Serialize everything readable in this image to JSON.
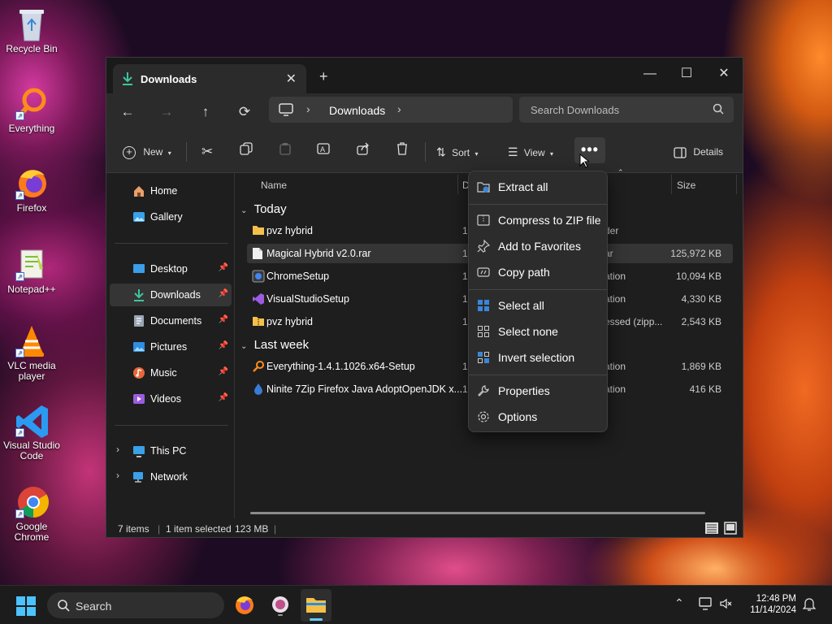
{
  "desktop": {
    "icons": [
      {
        "label": "Recycle Bin",
        "icon": "recycle-bin-icon"
      },
      {
        "label": "Everything",
        "icon": "everything-icon"
      },
      {
        "label": "Firefox",
        "icon": "firefox-icon"
      },
      {
        "label": "Notepad++",
        "icon": "notepad-plus-plus-icon"
      },
      {
        "label": "VLC media player",
        "icon": "vlc-icon"
      },
      {
        "label": "Visual Studio Code",
        "icon": "vscode-icon"
      },
      {
        "label": "Google Chrome",
        "icon": "chrome-icon"
      }
    ]
  },
  "window": {
    "tab_title": "Downloads",
    "new_tab": "+",
    "close_tab": "✕",
    "controls": {
      "minimize": "—",
      "maximize": "☐",
      "close": "✕"
    },
    "nav": {
      "back": "←",
      "forward": "→",
      "up": "↑",
      "refresh": "⟳"
    },
    "address": {
      "location": "Downloads",
      "separator": "›"
    },
    "search": {
      "placeholder": "Search Downloads"
    },
    "toolbar": {
      "new": "New",
      "sort": "Sort",
      "view": "View",
      "details": "Details",
      "more": "•••"
    },
    "sidebar": [
      {
        "label": "Home",
        "icon": "home-icon"
      },
      {
        "label": "Gallery",
        "icon": "gallery-icon"
      },
      {
        "label": "Desktop",
        "icon": "desktop-icon",
        "pinned": true
      },
      {
        "label": "Downloads",
        "icon": "downloads-icon",
        "pinned": true,
        "selected": true
      },
      {
        "label": "Documents",
        "icon": "documents-icon",
        "pinned": true
      },
      {
        "label": "Pictures",
        "icon": "pictures-icon",
        "pinned": true
      },
      {
        "label": "Music",
        "icon": "music-icon",
        "pinned": true
      },
      {
        "label": "Videos",
        "icon": "videos-icon",
        "pinned": true
      },
      {
        "label": "This PC",
        "icon": "this-pc-icon",
        "expandable": true
      },
      {
        "label": "Network",
        "icon": "network-icon",
        "expandable": true
      }
    ],
    "columns": {
      "name": "Name",
      "date": "D",
      "size": "Size"
    },
    "groups": [
      {
        "label": "Today",
        "files": [
          {
            "name": "pvz hybrid",
            "date": "1",
            "type": "der",
            "size": "",
            "icon": "folder-icon"
          },
          {
            "name": "Magical Hybrid v2.0.rar",
            "date": "1",
            "type": "ar",
            "size": "125,972 KB",
            "icon": "rar-file-icon",
            "selected": true
          },
          {
            "name": "ChromeSetup",
            "date": "1",
            "type": "ation",
            "size": "10,094 KB",
            "icon": "chrome-setup-icon"
          },
          {
            "name": "VisualStudioSetup",
            "date": "1",
            "type": "ation",
            "size": "4,330 KB",
            "icon": "visual-studio-setup-icon"
          },
          {
            "name": "pvz hybrid",
            "date": "1",
            "type": "essed (zipp...",
            "size": "2,543 KB",
            "icon": "zip-folder-icon"
          }
        ]
      },
      {
        "label": "Last week",
        "files": [
          {
            "name": "Everything-1.4.1.1026.x64-Setup",
            "date": "1",
            "type": "ation",
            "size": "1,869 KB",
            "icon": "everything-setup-icon"
          },
          {
            "name": "Ninite 7Zip Firefox Java AdoptOpenJDK x...",
            "date": "1",
            "type": "ation",
            "size": "416 KB",
            "icon": "ninite-icon"
          }
        ]
      }
    ],
    "status": {
      "items": "7 items",
      "selected": "1 item selected",
      "size": "123 MB"
    }
  },
  "context_menu": [
    {
      "label": "Extract all",
      "icon": "extract-icon"
    },
    {
      "label": "Compress to ZIP file",
      "icon": "zip-icon"
    },
    {
      "label": "Add to Favorites",
      "icon": "pin-icon"
    },
    {
      "label": "Copy path",
      "icon": "copy-path-icon"
    },
    {
      "label": "Select all",
      "icon": "select-all-icon"
    },
    {
      "label": "Select none",
      "icon": "select-none-icon"
    },
    {
      "label": "Invert selection",
      "icon": "invert-selection-icon"
    },
    {
      "label": "Properties",
      "icon": "properties-icon"
    },
    {
      "label": "Options",
      "icon": "options-icon"
    }
  ],
  "taskbar": {
    "search": "Search",
    "time": "12:48 PM",
    "date": "11/14/2024"
  },
  "colors": {
    "accent": "#60cdff",
    "folder": "#f5c04a",
    "window_bg": "#1e1e1e",
    "selection": "#353535"
  }
}
